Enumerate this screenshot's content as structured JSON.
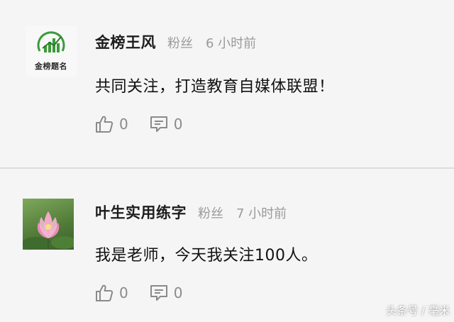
{
  "comments": [
    {
      "username": "金榜王风",
      "badge": "粉丝",
      "time": "6 小时前",
      "text": "共同关注，打造教育自媒体联盟！",
      "likes": "0",
      "replies": "0",
      "avatar": {
        "type": "logo",
        "logo_text": "金榜题名",
        "logo_color": "#3a9b3a"
      }
    },
    {
      "username": "叶生实用练字",
      "badge": "粉丝",
      "time": "7 小时前",
      "text": "我是老师，今天我关注100人。",
      "likes": "0",
      "replies": "0",
      "avatar": {
        "type": "photo",
        "subject": "lotus-flower"
      }
    }
  ],
  "watermark": "头条号 / 毫米",
  "colors": {
    "background": "#f5f5f5",
    "divider": "#dcdcdc",
    "meta_gray": "#9a9a9a",
    "icon_gray": "#8a8a8a"
  },
  "icons": [
    "thumbs-up-icon",
    "comment-icon"
  ]
}
